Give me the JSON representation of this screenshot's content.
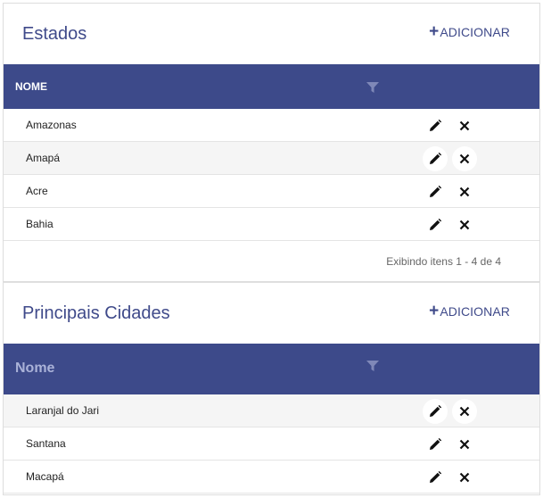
{
  "states": {
    "title": "Estados",
    "add_label": "ADICIONAR",
    "column": "NOME",
    "rows": [
      "Amazonas",
      "Amapá",
      "Acre",
      "Bahia"
    ],
    "pager_info": "Exibindo itens 1 - 4 de 4"
  },
  "cities": {
    "title": "Principais Cidades",
    "add_label": "ADICIONAR",
    "column": "Nome",
    "rows": [
      "Laranjal do Jari",
      "Santana",
      "Macapá"
    ]
  },
  "icons": {
    "add": "plus-icon",
    "filter": "filter-icon",
    "edit": "pencil-icon",
    "delete": "close-icon"
  },
  "colors": {
    "brand": "#3d4a8a",
    "alt_row": "#f5f5f5"
  }
}
